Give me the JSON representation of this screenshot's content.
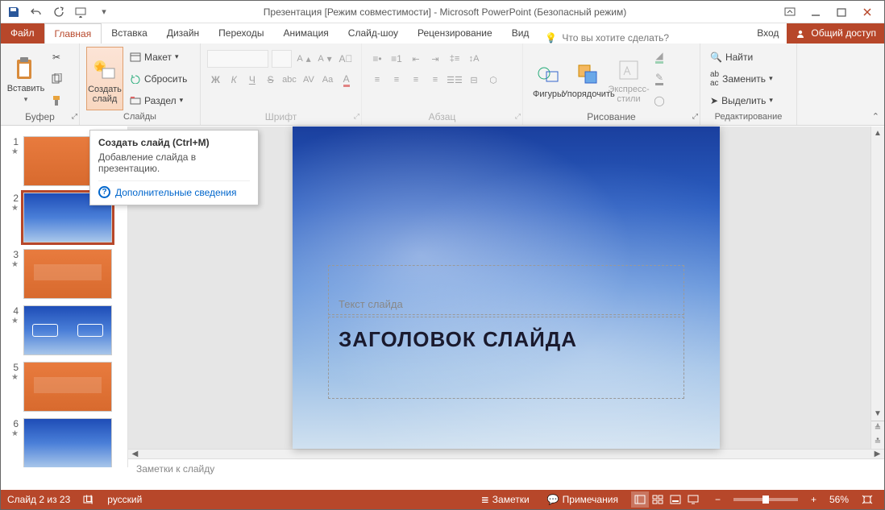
{
  "titlebar": {
    "title": "Презентация [Режим совместимости] - Microsoft PowerPoint (Безопасный режим)"
  },
  "tabs": {
    "file": "Файл",
    "home": "Главная",
    "insert": "Вставка",
    "design": "Дизайн",
    "transitions": "Переходы",
    "animations": "Анимация",
    "slideshow": "Слайд-шоу",
    "review": "Рецензирование",
    "view": "Вид",
    "tellme": "Что вы хотите сделать?",
    "signin": "Вход",
    "share": "Общий доступ"
  },
  "ribbon": {
    "clipboard": {
      "label": "Буфер обмена",
      "paste": "Вставить"
    },
    "slides": {
      "label": "Слайды",
      "new_slide": "Создать\nслайд",
      "layout": "Макет",
      "reset": "Сбросить",
      "section": "Раздел"
    },
    "font": {
      "label": "Шрифт"
    },
    "paragraph": {
      "label": "Абзац"
    },
    "drawing": {
      "label": "Рисование",
      "shapes": "Фигуры",
      "arrange": "Упорядочить",
      "styles": "Экспресс-\nстили"
    },
    "editing": {
      "label": "Редактирование",
      "find": "Найти",
      "replace": "Заменить",
      "select": "Выделить"
    }
  },
  "tooltip": {
    "title": "Создать слайд (Ctrl+M)",
    "body": "Добавление слайда в презентацию.",
    "link": "Дополнительные сведения"
  },
  "slide": {
    "subtitle_ph": "Текст слайда",
    "title_ph": "ЗАГОЛОВОК СЛАЙДА"
  },
  "notes": {
    "placeholder": "Заметки к слайду"
  },
  "status": {
    "slide_count": "Слайд 2 из 23",
    "language": "русский",
    "notes_btn": "Заметки",
    "comments_btn": "Примечания",
    "zoom": "56%"
  },
  "thumbs": [
    {
      "n": "1",
      "variant": "orange"
    },
    {
      "n": "2",
      "variant": "sky",
      "selected": true
    },
    {
      "n": "3",
      "variant": "orange txt"
    },
    {
      "n": "4",
      "variant": "sky boxes"
    },
    {
      "n": "5",
      "variant": "orange txt"
    },
    {
      "n": "6",
      "variant": "sky"
    }
  ]
}
